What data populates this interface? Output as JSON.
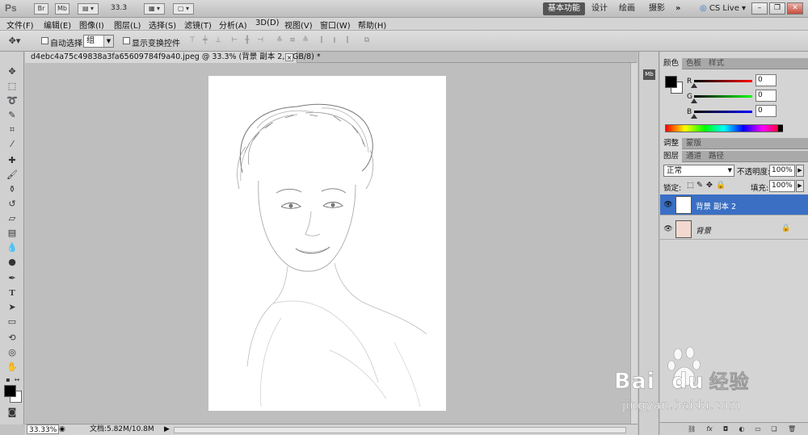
{
  "titlebar": {
    "app_logo": "Ps",
    "bridge": "Br",
    "minibridge": "Mb",
    "zoom": "33.3",
    "workspaces": [
      "基本功能",
      "设计",
      "绘画",
      "摄影"
    ],
    "more": "»",
    "cslive": "CS Live"
  },
  "menu": [
    "文件(F)",
    "编辑(E)",
    "图像(I)",
    "图层(L)",
    "选择(S)",
    "滤镜(T)",
    "分析(A)",
    "3D(D)",
    "视图(V)",
    "窗口(W)",
    "帮助(H)"
  ],
  "options": {
    "auto_select_label": "自动选择:",
    "auto_select_value": "组",
    "show_transform_label": "显示变换控件"
  },
  "document": {
    "tab_title": "d4ebc4a75c49838a3fa65609784f9a40.jpeg @ 33.3% (背景 副本 2, RGB/8) *",
    "close": "×"
  },
  "status": {
    "zoom": "33.33%",
    "doc_info": "文档:5.82M/10.8M"
  },
  "color_panel": {
    "tabs": [
      "颜色",
      "色板",
      "样式"
    ],
    "r_label": "R",
    "g_label": "G",
    "b_label": "B",
    "r_value": "0",
    "g_value": "0",
    "b_value": "0",
    "fg_color": "#000000",
    "bg_color": "#ffffff"
  },
  "adjust_panel": {
    "tabs": [
      "调整",
      "蒙版"
    ]
  },
  "layers_panel": {
    "tabs": [
      "图层",
      "通道",
      "路径"
    ],
    "blend_mode": "正常",
    "opacity_label": "不透明度:",
    "opacity_value": "100%",
    "lock_label": "锁定:",
    "fill_label": "填充:",
    "fill_value": "100%",
    "layers": [
      {
        "name": "背景 副本 2",
        "selected": true
      },
      {
        "name": "背景",
        "selected": false,
        "locked": true
      }
    ]
  },
  "watermark": {
    "brand_a": "Bai",
    "brand_b": "du",
    "brand_cn": "经验",
    "url": "jingyan.baidu.com"
  }
}
